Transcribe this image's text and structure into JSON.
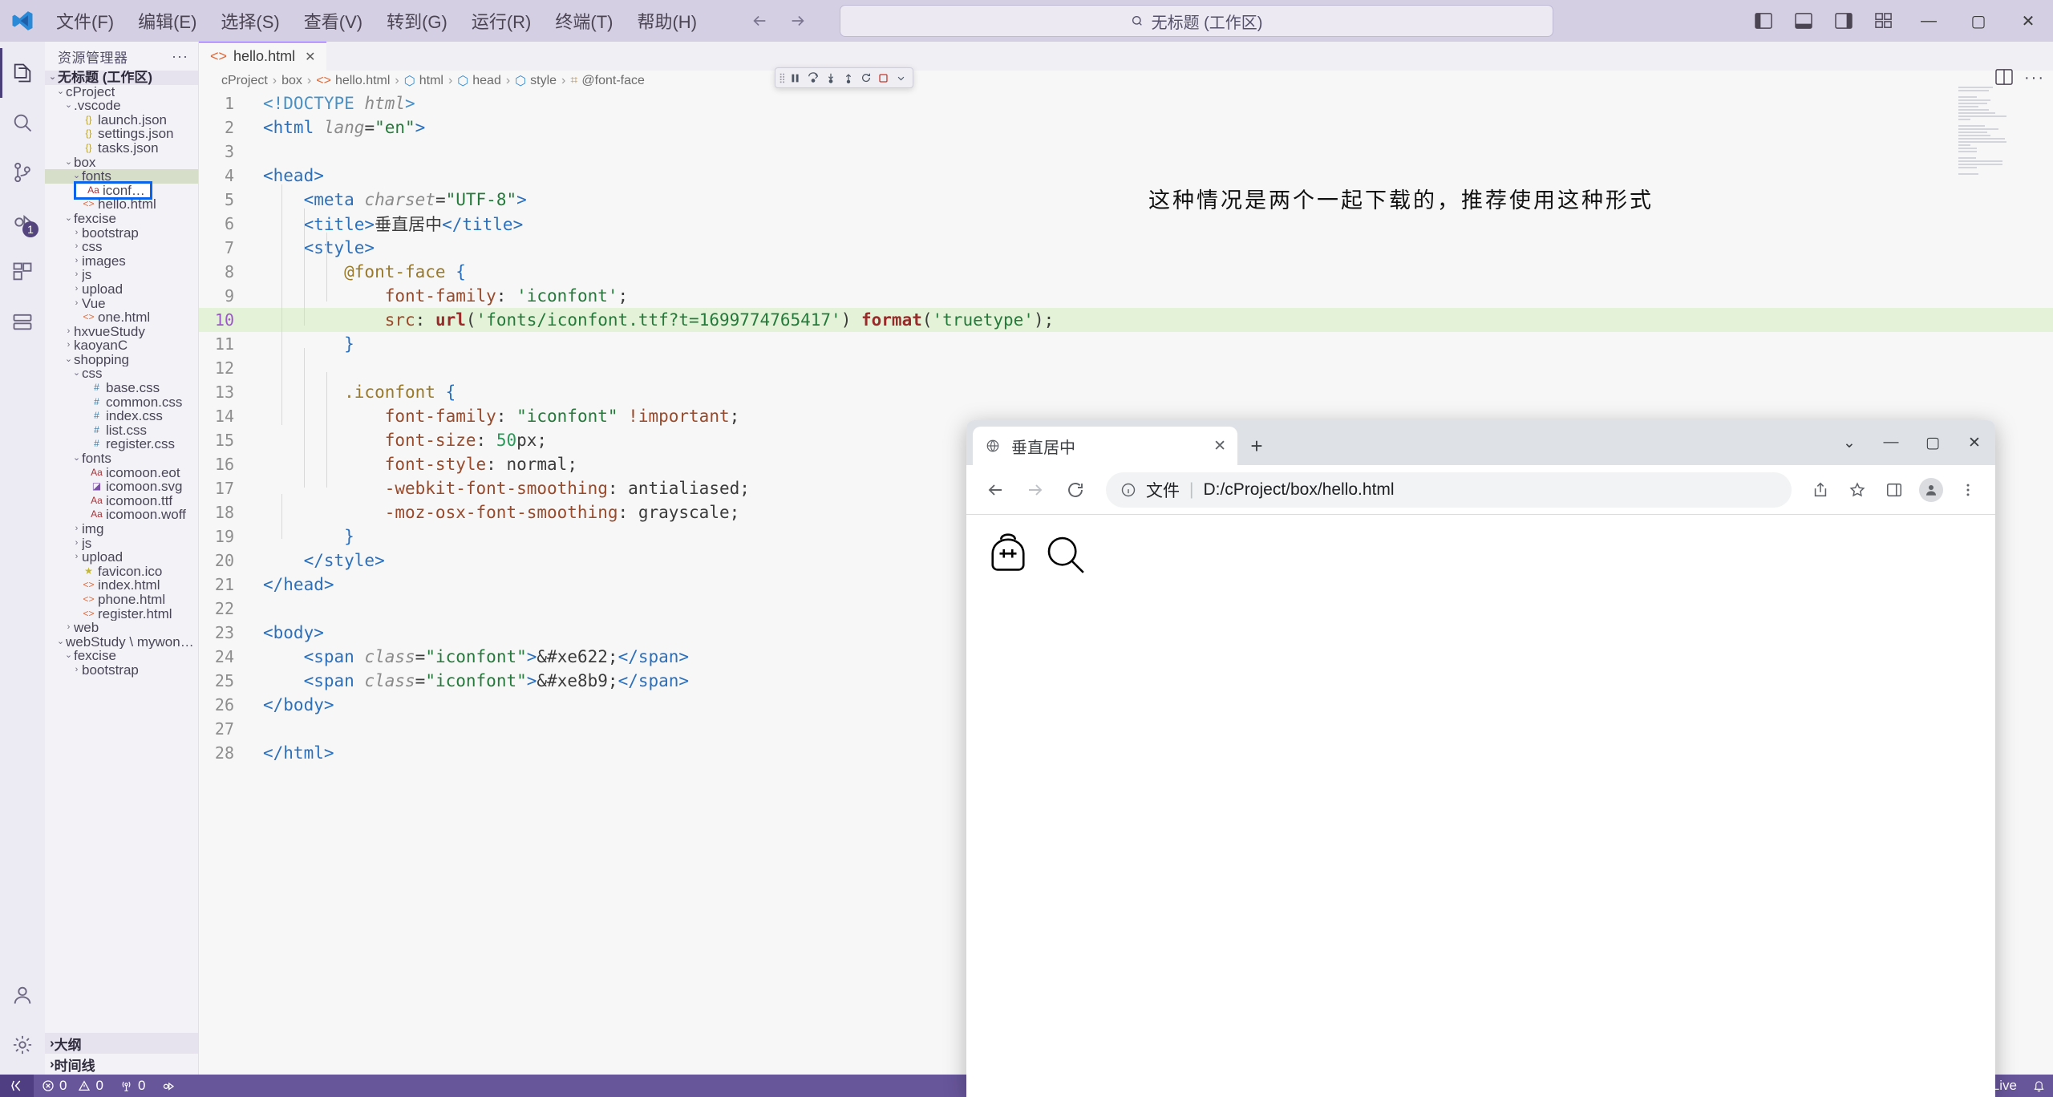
{
  "titlebar": {
    "menus": [
      "文件(F)",
      "编辑(E)",
      "选择(S)",
      "查看(V)",
      "转到(G)",
      "运行(R)",
      "终端(T)",
      "帮助(H)"
    ],
    "search_text": "无标题 (工作区)",
    "search_icon": "search-icon",
    "back_icon": "arrow-left-icon",
    "forward_icon": "arrow-right-icon",
    "window_minimize": "—",
    "window_maximize": "▢",
    "window_close": "✕"
  },
  "activitybar": {
    "items": [
      {
        "name": "explorer",
        "icon": "files-icon",
        "badge": ""
      },
      {
        "name": "search",
        "icon": "search-icon",
        "badge": ""
      },
      {
        "name": "source-control",
        "icon": "source-control-icon",
        "badge": ""
      },
      {
        "name": "run-and-debug",
        "icon": "debug-icon",
        "badge": "1"
      },
      {
        "name": "extensions",
        "icon": "extensions-icon",
        "badge": ""
      },
      {
        "name": "remote-explorer",
        "icon": "remote-icon",
        "badge": ""
      }
    ],
    "bottom": [
      {
        "name": "accounts",
        "icon": "account-icon"
      },
      {
        "name": "settings",
        "icon": "gear-icon"
      }
    ]
  },
  "sidebar": {
    "title": "资源管理器",
    "more_actions": "···",
    "tree": [
      {
        "label": "无标题 (工作区)",
        "indent": 0,
        "twisty": "down",
        "icon": "",
        "kind": "workspace"
      },
      {
        "label": "cProject",
        "indent": 1,
        "twisty": "down",
        "icon": "",
        "kind": "folder"
      },
      {
        "label": ".vscode",
        "indent": 2,
        "twisty": "down",
        "icon": "",
        "kind": "folder"
      },
      {
        "label": "launch.json",
        "indent": 3,
        "twisty": "",
        "icon": "{}",
        "kind": "json"
      },
      {
        "label": "settings.json",
        "indent": 3,
        "twisty": "",
        "icon": "{}",
        "kind": "json"
      },
      {
        "label": "tasks.json",
        "indent": 3,
        "twisty": "",
        "icon": "{}",
        "kind": "json"
      },
      {
        "label": "box",
        "indent": 2,
        "twisty": "down",
        "icon": "",
        "kind": "folder"
      },
      {
        "label": "fonts",
        "indent": 3,
        "twisty": "down",
        "icon": "",
        "kind": "folder",
        "state": "selected"
      },
      {
        "label": "iconfont.ttf",
        "indent": 4,
        "twisty": "",
        "icon": "Aa",
        "kind": "font",
        "state": "highlighted"
      },
      {
        "label": "hello.html",
        "indent": 3,
        "twisty": "",
        "icon": "<>",
        "kind": "html"
      },
      {
        "label": "fexcise",
        "indent": 2,
        "twisty": "down",
        "icon": "",
        "kind": "folder"
      },
      {
        "label": "bootstrap",
        "indent": 3,
        "twisty": "right",
        "icon": "",
        "kind": "folder"
      },
      {
        "label": "css",
        "indent": 3,
        "twisty": "right",
        "icon": "",
        "kind": "folder"
      },
      {
        "label": "images",
        "indent": 3,
        "twisty": "right",
        "icon": "",
        "kind": "folder"
      },
      {
        "label": "js",
        "indent": 3,
        "twisty": "right",
        "icon": "",
        "kind": "folder"
      },
      {
        "label": "upload",
        "indent": 3,
        "twisty": "right",
        "icon": "",
        "kind": "folder"
      },
      {
        "label": "Vue",
        "indent": 3,
        "twisty": "right",
        "icon": "",
        "kind": "folder"
      },
      {
        "label": "one.html",
        "indent": 3,
        "twisty": "",
        "icon": "<>",
        "kind": "html"
      },
      {
        "label": "hxvueStudy",
        "indent": 2,
        "twisty": "right",
        "icon": "",
        "kind": "folder"
      },
      {
        "label": "kaoyanC",
        "indent": 2,
        "twisty": "right",
        "icon": "",
        "kind": "folder"
      },
      {
        "label": "shopping",
        "indent": 2,
        "twisty": "down",
        "icon": "",
        "kind": "folder"
      },
      {
        "label": "css",
        "indent": 3,
        "twisty": "down",
        "icon": "",
        "kind": "folder"
      },
      {
        "label": "base.css",
        "indent": 4,
        "twisty": "",
        "icon": "#",
        "kind": "css"
      },
      {
        "label": "common.css",
        "indent": 4,
        "twisty": "",
        "icon": "#",
        "kind": "css"
      },
      {
        "label": "index.css",
        "indent": 4,
        "twisty": "",
        "icon": "#",
        "kind": "css"
      },
      {
        "label": "list.css",
        "indent": 4,
        "twisty": "",
        "icon": "#",
        "kind": "css"
      },
      {
        "label": "register.css",
        "indent": 4,
        "twisty": "",
        "icon": "#",
        "kind": "css"
      },
      {
        "label": "fonts",
        "indent": 3,
        "twisty": "down",
        "icon": "",
        "kind": "folder"
      },
      {
        "label": "icomoon.eot",
        "indent": 4,
        "twisty": "",
        "icon": "Aa",
        "kind": "font"
      },
      {
        "label": "icomoon.svg",
        "indent": 4,
        "twisty": "",
        "icon": "◪",
        "kind": "svg"
      },
      {
        "label": "icomoon.ttf",
        "indent": 4,
        "twisty": "",
        "icon": "Aa",
        "kind": "font"
      },
      {
        "label": "icomoon.woff",
        "indent": 4,
        "twisty": "",
        "icon": "Aa",
        "kind": "font"
      },
      {
        "label": "img",
        "indent": 3,
        "twisty": "right",
        "icon": "",
        "kind": "folder"
      },
      {
        "label": "js",
        "indent": 3,
        "twisty": "right",
        "icon": "",
        "kind": "folder"
      },
      {
        "label": "upload",
        "indent": 3,
        "twisty": "right",
        "icon": "",
        "kind": "folder"
      },
      {
        "label": "favicon.ico",
        "indent": 3,
        "twisty": "",
        "icon": "★",
        "kind": "star"
      },
      {
        "label": "index.html",
        "indent": 3,
        "twisty": "",
        "icon": "<>",
        "kind": "html"
      },
      {
        "label": "phone.html",
        "indent": 3,
        "twisty": "",
        "icon": "<>",
        "kind": "html"
      },
      {
        "label": "register.html",
        "indent": 3,
        "twisty": "",
        "icon": "<>",
        "kind": "html"
      },
      {
        "label": "web",
        "indent": 2,
        "twisty": "right",
        "icon": "",
        "kind": "folder"
      },
      {
        "label": "webStudy \\ mywonder",
        "indent": 1,
        "twisty": "down",
        "icon": "",
        "kind": "folder"
      },
      {
        "label": "fexcise",
        "indent": 2,
        "twisty": "down",
        "icon": "",
        "kind": "folder"
      },
      {
        "label": "bootstrap",
        "indent": 3,
        "twisty": "right",
        "icon": "",
        "kind": "folder"
      }
    ],
    "footer": [
      {
        "label": "大纲",
        "twisty": "right"
      },
      {
        "label": "时间线",
        "twisty": "right"
      }
    ]
  },
  "editor": {
    "tab": {
      "label": "hello.html",
      "icon": "html-icon",
      "close": "✕"
    },
    "breadcrumbs": [
      {
        "label": "cProject",
        "icon": ""
      },
      {
        "label": "box",
        "icon": ""
      },
      {
        "label": "hello.html",
        "icon": "html-icon"
      },
      {
        "label": "html",
        "icon": "symbol-icon"
      },
      {
        "label": "head",
        "icon": "symbol-icon"
      },
      {
        "label": "style",
        "icon": "symbol-icon"
      },
      {
        "label": "@font-face",
        "icon": "css-rule-icon"
      }
    ],
    "breadcrumb_separator": "›",
    "split_icon": "split-editor-icon",
    "more_icon": "more-actions-icon",
    "runbar": {
      "grip": "⠿",
      "buttons": [
        "pause-icon",
        "step-over-icon",
        "step-into-icon",
        "step-out-icon",
        "restart-icon",
        "stop-icon",
        "chevron-down-icon"
      ]
    },
    "lines": [
      {
        "n": 1,
        "tokens": [
          {
            "t": "<!DOCTYPE ",
            "c": "t-br"
          },
          {
            "t": "html",
            "c": "t-attr"
          },
          {
            "t": ">",
            "c": "t-br"
          }
        ]
      },
      {
        "n": 2,
        "tokens": [
          {
            "t": "<html ",
            "c": "t-tag"
          },
          {
            "t": "lang",
            "c": "t-attr"
          },
          {
            "t": "=",
            "c": "t-plain"
          },
          {
            "t": "\"en\"",
            "c": "t-str"
          },
          {
            "t": ">",
            "c": "t-tag"
          }
        ]
      },
      {
        "n": 3,
        "tokens": []
      },
      {
        "n": 4,
        "tokens": [
          {
            "t": "<head>",
            "c": "t-tag"
          }
        ]
      },
      {
        "n": 5,
        "tokens": [
          {
            "t": "    <meta ",
            "c": "t-tag"
          },
          {
            "t": "charset",
            "c": "t-attr"
          },
          {
            "t": "=",
            "c": "t-plain"
          },
          {
            "t": "\"UTF-8\"",
            "c": "t-str"
          },
          {
            "t": ">",
            "c": "t-tag"
          }
        ]
      },
      {
        "n": 6,
        "tokens": [
          {
            "t": "    <title>",
            "c": "t-tag"
          },
          {
            "t": "垂直居中",
            "c": "t-cjk"
          },
          {
            "t": "</title>",
            "c": "t-tag"
          }
        ]
      },
      {
        "n": 7,
        "tokens": [
          {
            "t": "    <style>",
            "c": "t-tag"
          }
        ]
      },
      {
        "n": 8,
        "tokens": [
          {
            "t": "        @font-face ",
            "c": "t-sel"
          },
          {
            "t": "{",
            "c": "t-brace"
          }
        ]
      },
      {
        "n": 9,
        "tokens": [
          {
            "t": "            font-family",
            "c": "t-key"
          },
          {
            "t": ": ",
            "c": "t-plain"
          },
          {
            "t": "'iconfont'",
            "c": "t-str"
          },
          {
            "t": ";",
            "c": "t-plain"
          }
        ]
      },
      {
        "n": 10,
        "highlight": true,
        "tokens": [
          {
            "t": "            src",
            "c": "t-key"
          },
          {
            "t": ": ",
            "c": "t-plain"
          },
          {
            "t": "url",
            "c": "t-fn"
          },
          {
            "t": "(",
            "c": "t-plain"
          },
          {
            "t": "'fonts/iconfont.ttf?t=1699774765417'",
            "c": "t-str"
          },
          {
            "t": ") ",
            "c": "t-plain"
          },
          {
            "t": "format",
            "c": "t-fn"
          },
          {
            "t": "(",
            "c": "t-plain"
          },
          {
            "t": "'truetype'",
            "c": "t-str"
          },
          {
            "t": ");",
            "c": "t-plain"
          }
        ]
      },
      {
        "n": 11,
        "tokens": [
          {
            "t": "        }",
            "c": "t-brace"
          }
        ]
      },
      {
        "n": 12,
        "tokens": []
      },
      {
        "n": 13,
        "tokens": [
          {
            "t": "        .iconfont ",
            "c": "t-sel"
          },
          {
            "t": "{",
            "c": "t-brace"
          }
        ]
      },
      {
        "n": 14,
        "tokens": [
          {
            "t": "            font-family",
            "c": "t-key"
          },
          {
            "t": ": ",
            "c": "t-plain"
          },
          {
            "t": "\"iconfont\"",
            "c": "t-str"
          },
          {
            "t": " !important",
            "c": "t-key"
          },
          {
            "t": ";",
            "c": "t-plain"
          }
        ]
      },
      {
        "n": 15,
        "tokens": [
          {
            "t": "            font-size",
            "c": "t-key"
          },
          {
            "t": ": ",
            "c": "t-plain"
          },
          {
            "t": "50",
            "c": "t-num"
          },
          {
            "t": "px;",
            "c": "t-plain"
          }
        ]
      },
      {
        "n": 16,
        "tokens": [
          {
            "t": "            font-style",
            "c": "t-key"
          },
          {
            "t": ": ",
            "c": "t-plain"
          },
          {
            "t": "normal",
            "c": "t-plain"
          },
          {
            "t": ";",
            "c": "t-plain"
          }
        ]
      },
      {
        "n": 17,
        "tokens": [
          {
            "t": "            -webkit-font-smoothing",
            "c": "t-key"
          },
          {
            "t": ": ",
            "c": "t-plain"
          },
          {
            "t": "antialiased",
            "c": "t-plain"
          },
          {
            "t": ";",
            "c": "t-plain"
          }
        ]
      },
      {
        "n": 18,
        "tokens": [
          {
            "t": "            -moz-osx-font-smoothing",
            "c": "t-key"
          },
          {
            "t": ": ",
            "c": "t-plain"
          },
          {
            "t": "grayscale",
            "c": "t-plain"
          },
          {
            "t": ";",
            "c": "t-plain"
          }
        ]
      },
      {
        "n": 19,
        "tokens": [
          {
            "t": "        }",
            "c": "t-brace"
          }
        ]
      },
      {
        "n": 20,
        "tokens": [
          {
            "t": "    </style>",
            "c": "t-tag"
          }
        ]
      },
      {
        "n": 21,
        "tokens": [
          {
            "t": "</head>",
            "c": "t-tag"
          }
        ]
      },
      {
        "n": 22,
        "tokens": []
      },
      {
        "n": 23,
        "tokens": [
          {
            "t": "<body>",
            "c": "t-tag"
          }
        ]
      },
      {
        "n": 24,
        "tokens": [
          {
            "t": "    <span ",
            "c": "t-tag"
          },
          {
            "t": "class",
            "c": "t-attr"
          },
          {
            "t": "=",
            "c": "t-plain"
          },
          {
            "t": "\"iconfont\"",
            "c": "t-str"
          },
          {
            "t": ">",
            "c": "t-tag"
          },
          {
            "t": "&#xe622;",
            "c": "t-plain"
          },
          {
            "t": "</span>",
            "c": "t-tag"
          }
        ]
      },
      {
        "n": 25,
        "tokens": [
          {
            "t": "    <span ",
            "c": "t-tag"
          },
          {
            "t": "class",
            "c": "t-attr"
          },
          {
            "t": "=",
            "c": "t-plain"
          },
          {
            "t": "\"iconfont\"",
            "c": "t-str"
          },
          {
            "t": ">",
            "c": "t-tag"
          },
          {
            "t": "&#xe8b9;",
            "c": "t-plain"
          },
          {
            "t": "</span>",
            "c": "t-tag"
          }
        ]
      },
      {
        "n": 26,
        "tokens": [
          {
            "t": "</body>",
            "c": "t-tag"
          }
        ]
      },
      {
        "n": 27,
        "tokens": []
      },
      {
        "n": 28,
        "tokens": [
          {
            "t": "</html>",
            "c": "t-tag"
          }
        ]
      }
    ]
  },
  "annotation": {
    "text": "这种情况是两个一起下载的，推荐使用这种形式"
  },
  "browser": {
    "tab_title": "垂直居中",
    "tab_close": "✕",
    "new_tab": "+",
    "window_controls": [
      "chevron-down-icon",
      "minimize-icon",
      "maximize-icon",
      "close-icon"
    ],
    "back_icon": "arrow-left-icon",
    "forward_icon": "arrow-right-icon",
    "reload_icon": "reload-icon",
    "info_icon": "info-icon",
    "scheme_label": "文件",
    "scheme_divider": "|",
    "url": "D:/cProject/box/hello.html",
    "toolbar_icons": [
      "share-icon",
      "bookmark-star-icon",
      "side-panel-icon",
      "profile-avatar-icon",
      "kebab-menu-icon"
    ],
    "page_glyphs": [
      "clock-icon",
      "search-icon"
    ]
  },
  "statusbar": {
    "remote_icon": "remote-indicator-icon",
    "errors": "0",
    "warnings": "0",
    "ports": "0",
    "error_icon": "error-circle-icon",
    "warning_icon": "warning-triangle-icon",
    "ports_icon": "radio-tower-icon",
    "debug_icon": "run-debug-icon",
    "golive_label": "Go Live",
    "bell_label": "🔔"
  },
  "colors": {
    "titlebar_bg": "#d4cfe3",
    "statusbar_bg": "#68569b",
    "highlight_line": "#e4f3d8",
    "selection": "#d6dec9",
    "annotation_box": "#0b63ea"
  }
}
